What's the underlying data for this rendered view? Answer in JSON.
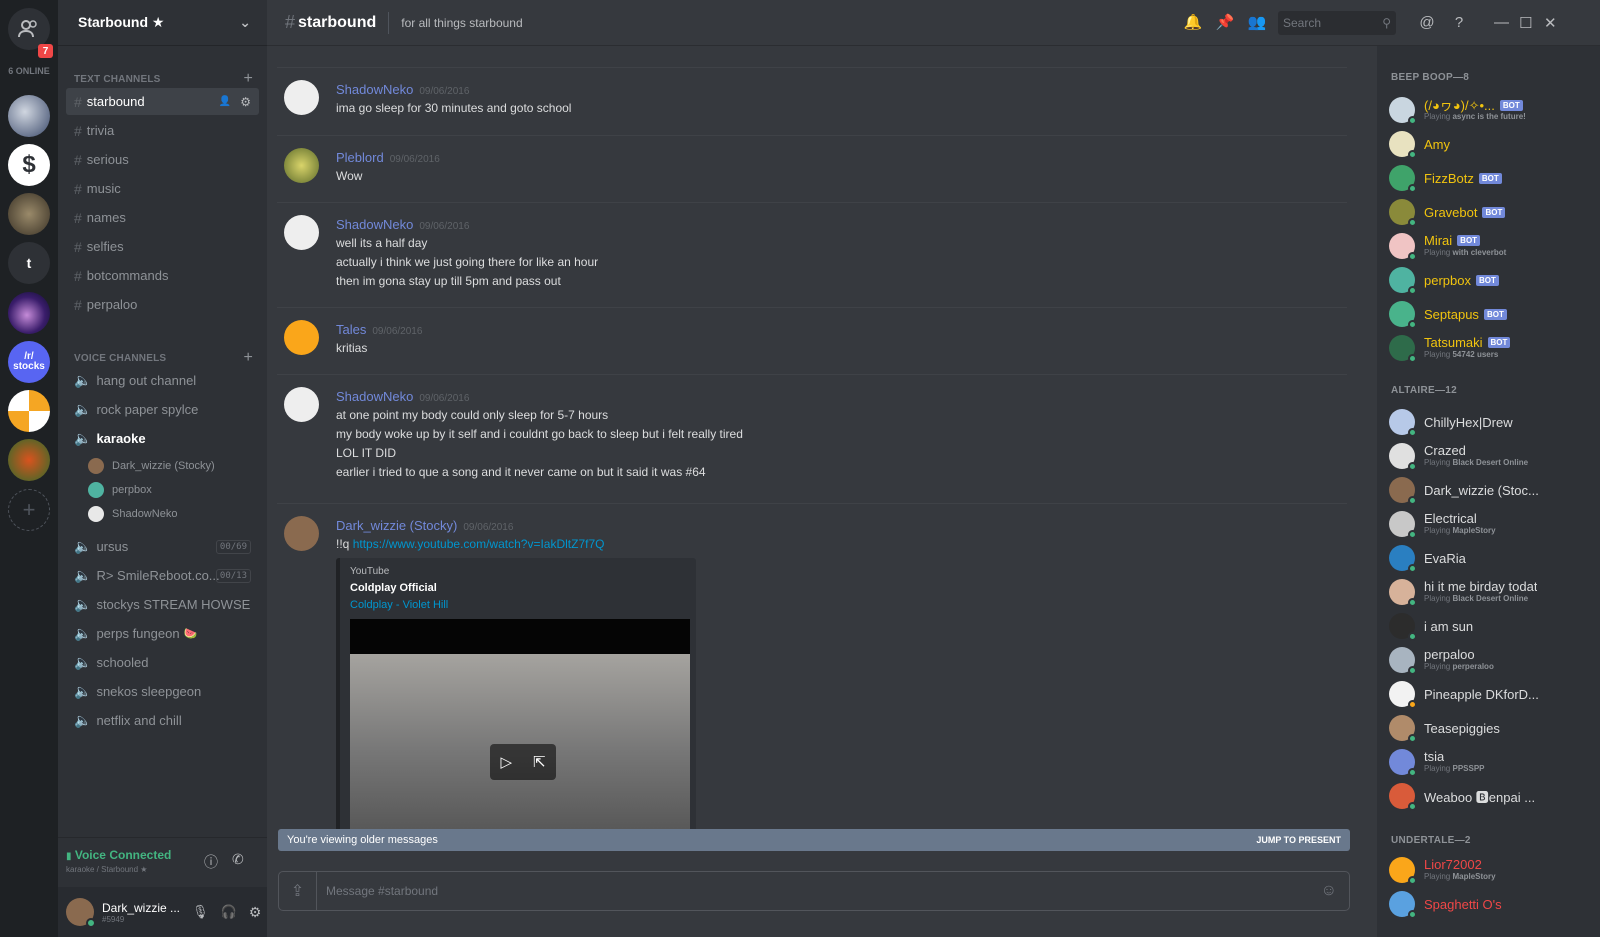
{
  "rail": {
    "badge": "7",
    "online": "6 ONLINE",
    "t_server": "t",
    "stocks_label": "/r/ stocks",
    "add": "+"
  },
  "guild": {
    "name": "Starbound ★",
    "chevron": "⌄"
  },
  "text_header": "TEXT CHANNELS",
  "text_channels": [
    "starbound",
    "trivia",
    "serious",
    "music",
    "names",
    "selfies",
    "botcommands",
    "perpaloo"
  ],
  "voice_header": "VOICE CHANNELS",
  "voice_channels": {
    "a": [
      "hang out channel",
      "rock paper spylce"
    ],
    "karaoke": "karaoke",
    "karaoke_users": [
      "Dark_wizzie (Stocky)",
      "perpbox",
      "ShadowNeko"
    ],
    "b": [
      {
        "name": "ursus",
        "count": "00/69"
      },
      {
        "name": "R> SmileReboot.co...",
        "count": "00/13"
      }
    ],
    "c": [
      "stockys STREAM HOWSE",
      "perps fungeon",
      "schooled",
      "snekos sleepgeon",
      "netflix and chill"
    ]
  },
  "voice_status": {
    "title": "Voice Connected",
    "sub": "karaoke / Starbound ★"
  },
  "me": {
    "name": "Dark_wizzie ...",
    "tag": "#5949"
  },
  "channel": {
    "name": "starbound",
    "topic": "for all things starbound",
    "search": "Search"
  },
  "messages": [
    {
      "user": "ShadowNeko",
      "time": "09/06/2016",
      "lines": [
        "ima go sleep for 30 minutes and goto school"
      ]
    },
    {
      "user": "Pleblord",
      "time": "09/06/2016",
      "lines": [
        "Wow"
      ]
    },
    {
      "user": "ShadowNeko",
      "time": "09/06/2016",
      "lines": [
        "well its a half day",
        "actually i think we just going there for like an hour",
        "then im gona stay up till 5pm and pass out"
      ]
    },
    {
      "user": "Tales",
      "time": "09/06/2016",
      "lines": [
        "kritias"
      ]
    },
    {
      "user": "ShadowNeko",
      "time": "09/06/2016",
      "lines": [
        "at one point my body could only sleep for 5-7 hours",
        "my body woke up by it self and i couldnt go back to sleep but i felt really tired",
        "LOL IT DID",
        "earlier i tried to que a song and it never  came on but it said it was #64"
      ]
    },
    {
      "user": "Dark_wizzie (Stocky)",
      "time": "09/06/2016",
      "prefix": "!!q ",
      "link": "https://www.youtube.com/watch?v=IakDltZ7f7Q"
    }
  ],
  "embed": {
    "provider": "YouTube",
    "author": "Coldplay Official",
    "title": "Coldplay - Violet Hill"
  },
  "older": {
    "text": "You're viewing older messages",
    "jump": "JUMP TO PRESENT"
  },
  "input": {
    "placeholder": "Message #starbound"
  },
  "groups": [
    {
      "label": "BEEP BOOP—8"
    },
    {
      "label": "ALTAIRE—12"
    },
    {
      "label": "UNDERTALE—2"
    }
  ],
  "members": [
    {
      "name": "(/◕ヮ◕)/✧•...",
      "bot": "BOT",
      "playing": "Playing",
      "game": "async is the future!"
    },
    {
      "name": "Amy"
    },
    {
      "name": "FizzBotz",
      "bot": "BOT"
    },
    {
      "name": "Gravebot",
      "bot": "BOT"
    },
    {
      "name": "Mirai",
      "bot": "BOT",
      "playing": "Playing",
      "game": "with cleverbot"
    },
    {
      "name": "perpbox",
      "bot": "BOT"
    },
    {
      "name": "Septapus",
      "bot": "BOT"
    },
    {
      "name": "Tatsumaki",
      "bot": "BOT",
      "playing": "Playing",
      "game": "54742 users"
    },
    {
      "name": "ChillyHex|Drew"
    },
    {
      "name": "Crazed",
      "playing": "Playing",
      "game": "Black Desert Online"
    },
    {
      "name": "Dark_wizzie (Stoc..."
    },
    {
      "name": "Electrical",
      "playing": "Playing",
      "game": "MapleStory"
    },
    {
      "name": "EvaRia"
    },
    {
      "name": "hi it me birday todat",
      "playing": "Playing",
      "game": "Black Desert Online"
    },
    {
      "name": "i am sun"
    },
    {
      "name": "perpaloo",
      "playing": "Playing",
      "game": "perperaloo"
    },
    {
      "name": "Pineapple DKforD..."
    },
    {
      "name": "Teasepiggies"
    },
    {
      "name": "tsia",
      "playing": "Playing",
      "game": "PPSSPP"
    },
    {
      "name": "Weaboo 🅱enpai ..."
    },
    {
      "name": "Lior72002",
      "playing": "Playing",
      "game": "MapleStory"
    },
    {
      "name": "Spaghetti O's"
    }
  ],
  "colors": {
    "accent": "#7289da",
    "online": "#43b581",
    "gold": "#f1c40f",
    "red": "#f04747"
  }
}
